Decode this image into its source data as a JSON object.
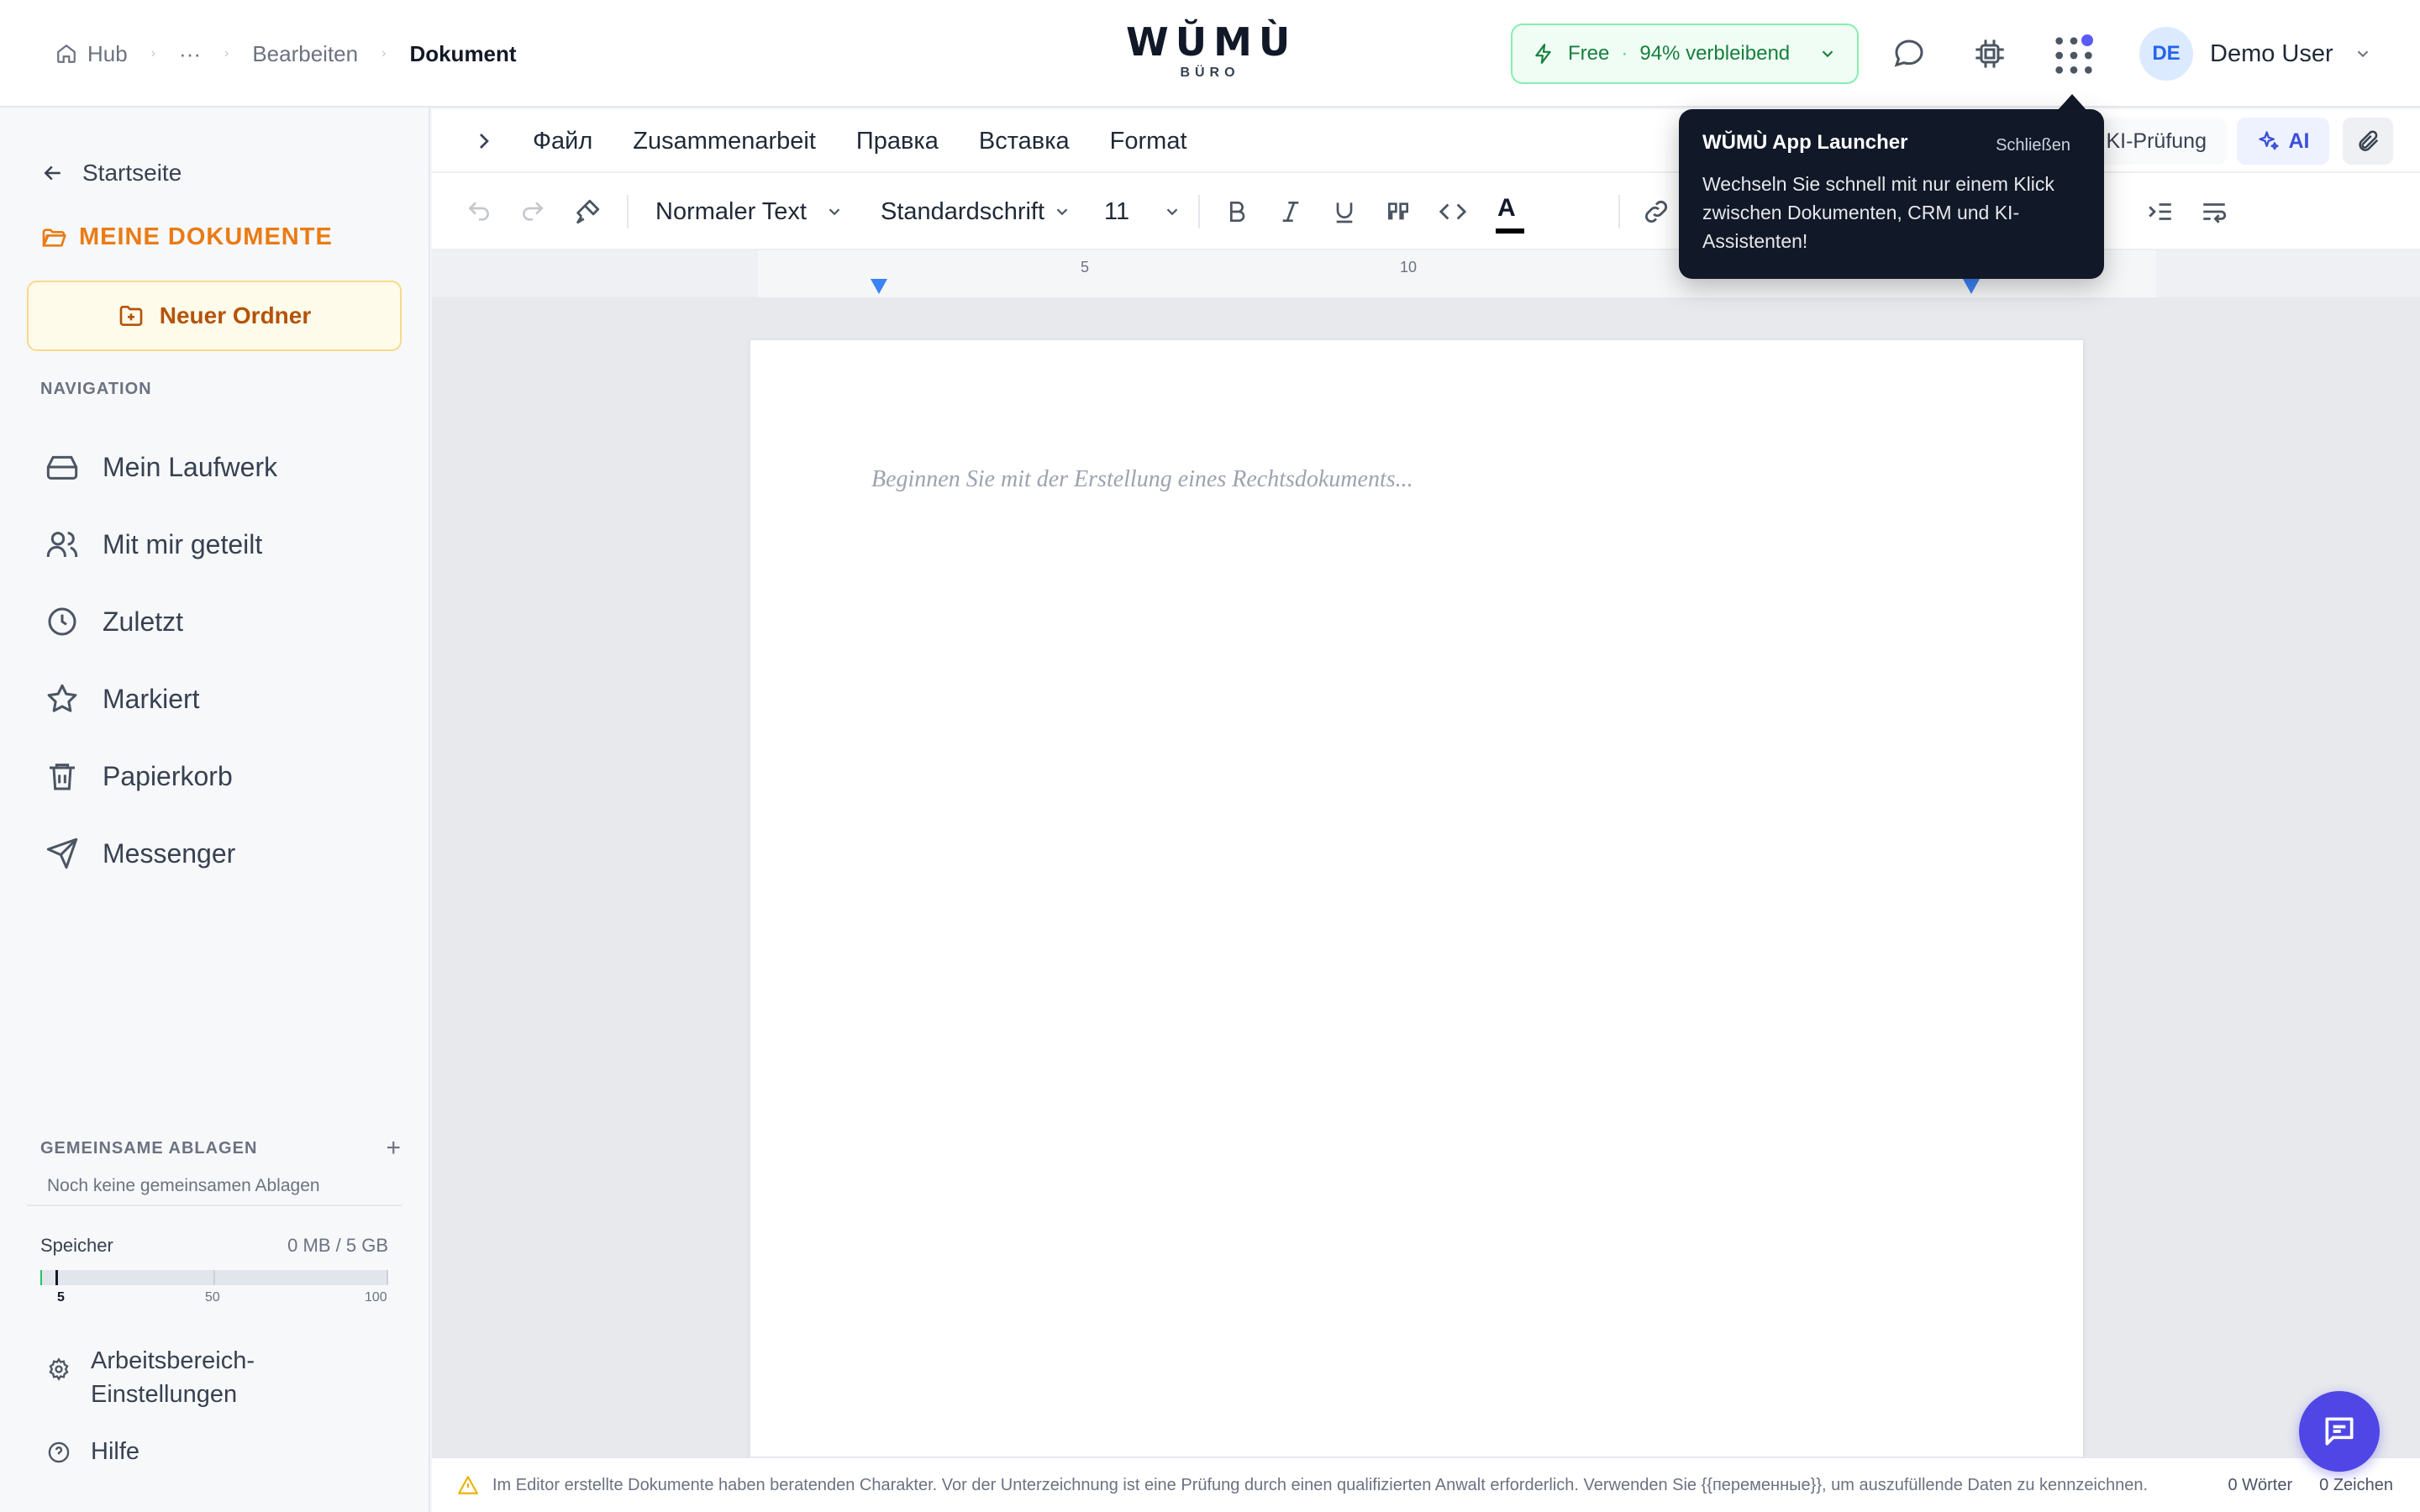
{
  "breadcrumb": {
    "home": "Hub",
    "ellipsis": "···",
    "edit": "Bearbeiten",
    "current": "Dokument"
  },
  "logo": {
    "main": "WŬMÙ",
    "sub": "BÜRO"
  },
  "plan": {
    "name": "Free",
    "separator": "·",
    "remaining": "94% verbleibend"
  },
  "user": {
    "initials": "DE",
    "name": "Demo User"
  },
  "sidebar": {
    "back": "Startseite",
    "section_title": "MEINE DOKUMENTE",
    "new_folder": "Neuer Ordner",
    "nav_heading": "NAVIGATION",
    "nav_items": [
      {
        "label": "Mein Laufwerk",
        "icon": "drive-icon"
      },
      {
        "label": "Mit mir geteilt",
        "icon": "users-icon"
      },
      {
        "label": "Zuletzt",
        "icon": "clock-icon"
      },
      {
        "label": "Markiert",
        "icon": "star-icon"
      },
      {
        "label": "Papierkorb",
        "icon": "trash-icon"
      },
      {
        "label": "Messenger",
        "icon": "send-icon"
      }
    ],
    "shared_heading": "GEMEINSAME ABLAGEN",
    "shared_add": "+",
    "shared_empty": "Noch keine gemeinsamen Ablagen",
    "storage": {
      "label": "Speicher",
      "value": "0 MB / 5 GB",
      "used_percent": 0,
      "scale": [
        "5",
        "50",
        "100"
      ]
    },
    "settings_line1": "Arbeitsbereich-",
    "settings_line2": "Einstellungen",
    "help": "Hilfe"
  },
  "menu": {
    "items": [
      "Файл",
      "Zusammenarbeit",
      "Правка",
      "Вставка",
      "Format"
    ],
    "ki_check": "KI-Prüfung",
    "ai": "AI"
  },
  "toolbar": {
    "paragraph_style": "Normaler Text",
    "font": "Standardschrift",
    "font_size": "11",
    "highlight": "ab",
    "text_color": "A"
  },
  "ruler": {
    "labels": [
      "5",
      "10"
    ]
  },
  "document": {
    "placeholder": "Beginnen Sie mit der Erstellung eines Rechtsdokuments..."
  },
  "status": {
    "notice": "Im Editor erstellte Dokumente haben beratenden Charakter. Vor der Unterzeichnung ist eine Prüfung durch einen qualifizierten Anwalt erforderlich. Verwenden Sie {{переменные}}, um auszufüllende Daten zu kennzeichnen.",
    "words": "0 Wörter",
    "chars": "0 Zeichen"
  },
  "tooltip": {
    "title": "WŬMÙ App Launcher",
    "close": "Schließen",
    "body": "Wechseln Sie schnell mit nur einem Klick zwischen Dokumenten, CRM und KI-Assistenten!"
  },
  "colors": {
    "accent": "#ea7b14",
    "plan_green": "#15803d",
    "ai_blue": "#3b4fd8",
    "fab": "#4f46e5"
  }
}
